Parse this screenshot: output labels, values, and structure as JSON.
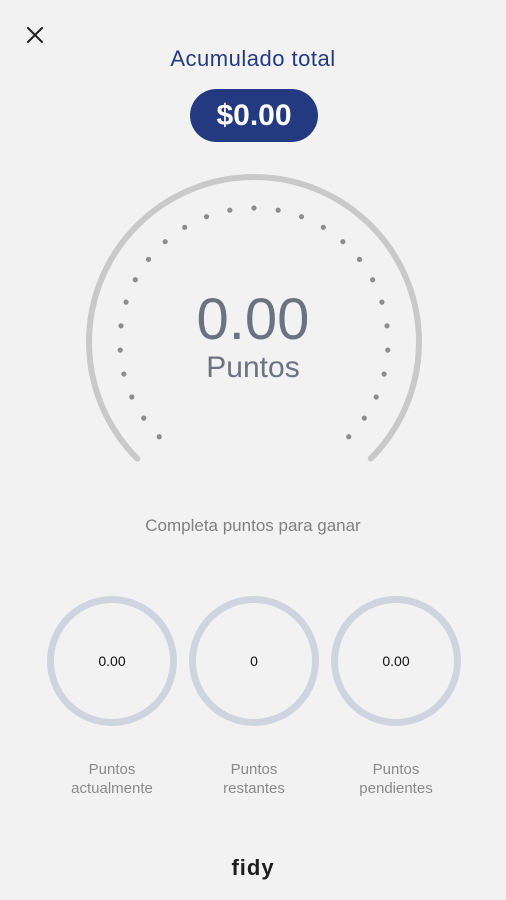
{
  "header": {
    "close_icon": "close-icon",
    "title": "Acumulado total",
    "total_amount": "$0.00"
  },
  "gauge": {
    "value": "0.00",
    "unit_label": "Puntos",
    "progress": 0,
    "track_color": "#c9c9c9",
    "dot_color": "#8d8d8d"
  },
  "subtitle": "Completa puntos para ganar",
  "stats": [
    {
      "value": "0.00",
      "label_line1": "Puntos",
      "label_line2": "actualmente"
    },
    {
      "value": "0",
      "label_line1": "Puntos",
      "label_line2": "restantes"
    },
    {
      "value": "0.00",
      "label_line1": "Puntos",
      "label_line2": "pendientes"
    }
  ],
  "brand": {
    "name": "fidy"
  },
  "colors": {
    "accent": "#243a80",
    "background": "#f2f2f2",
    "ring": "#cfd4df"
  }
}
